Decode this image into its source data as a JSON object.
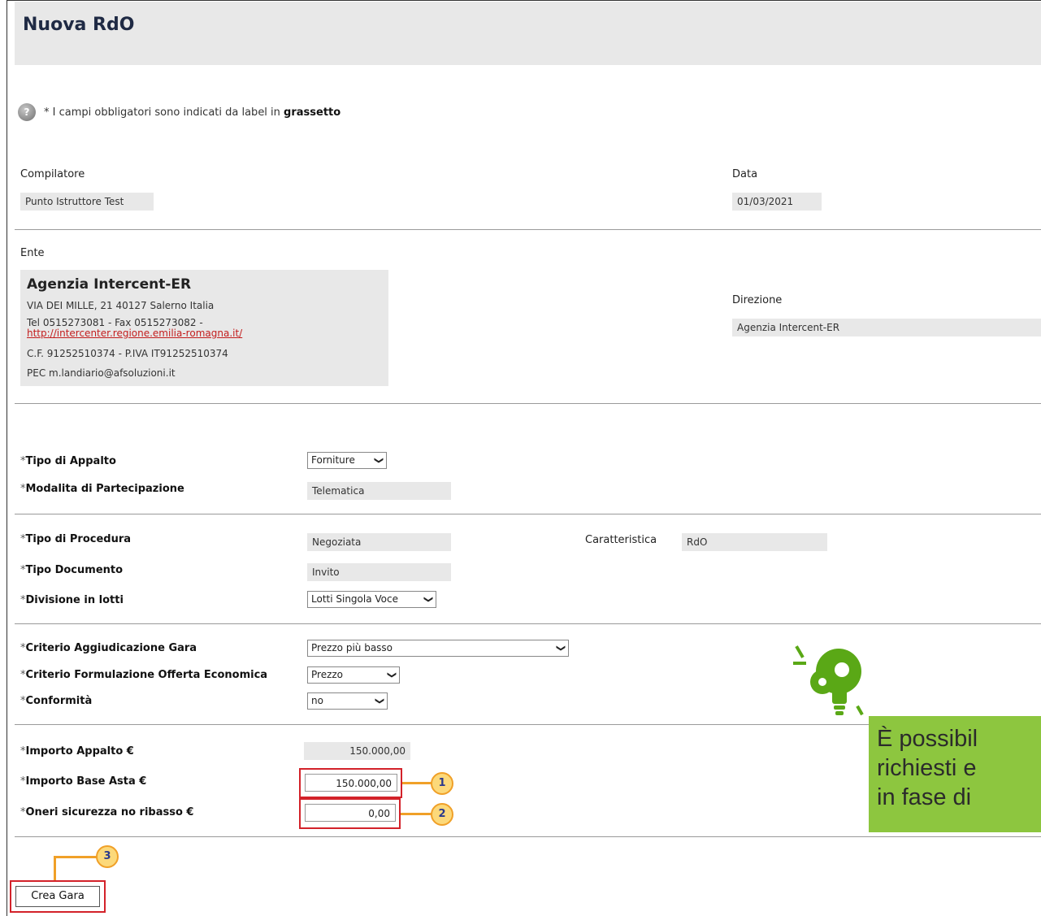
{
  "page": {
    "title": "Nuova RdO"
  },
  "note": {
    "text": "* I campi obbligatori sono indicati da label in ",
    "bold": "grassetto"
  },
  "compilatore": {
    "label": "Compilatore",
    "value": "Punto Istruttore Test"
  },
  "data": {
    "label": "Data",
    "value": "01/03/2021"
  },
  "ente": {
    "label": "Ente",
    "name": "Agenzia Intercent-ER",
    "address": "VIA DEI MILLE, 21 40127 Salerno Italia",
    "phone": "Tel 0515273081 - Fax 0515273082 -",
    "url": "http://intercenter.regione.emilia-romagna.it/",
    "fiscal": "C.F. 91252510374 - P.IVA IT91252510374",
    "pec": "PEC m.landiario@afsoluzioni.it"
  },
  "direzione": {
    "label": "Direzione",
    "value": "Agenzia Intercent-ER"
  },
  "fields": {
    "tipo_appalto": {
      "label": "Tipo di Appalto",
      "value": "Forniture"
    },
    "modalita": {
      "label": "Modalita di Partecipazione",
      "value": "Telematica"
    },
    "tipo_procedura": {
      "label": "Tipo di Procedura",
      "value": "Negoziata"
    },
    "caratteristica": {
      "label": "Caratteristica",
      "value": "RdO"
    },
    "tipo_documento": {
      "label": "Tipo Documento",
      "value": "Invito"
    },
    "divisione_lotti": {
      "label": "Divisione in lotti",
      "value": "Lotti Singola Voce"
    },
    "criterio_aggiudicazione": {
      "label": "Criterio Aggiudicazione Gara",
      "value": "Prezzo più basso"
    },
    "criterio_formulazione": {
      "label": "Criterio Formulazione Offerta Economica",
      "value": "Prezzo"
    },
    "conformita": {
      "label": "Conformità",
      "value": "no"
    },
    "importo_appalto": {
      "label": "Importo Appalto €",
      "value": "150.000,00"
    },
    "importo_base_asta": {
      "label": "Importo Base Asta €",
      "value": "150.000,00"
    },
    "oneri_sicurezza": {
      "label": "Oneri sicurezza no ribasso €",
      "value": "0,00"
    }
  },
  "asterisk": "*",
  "callouts": [
    "1",
    "2",
    "3"
  ],
  "create_button": "Crea Gara",
  "tip": {
    "line1": "È possibil",
    "line2": "richiesti e",
    "line3": "in fase di"
  },
  "icons": {
    "help": "help-circle-icon",
    "tip": "lightbulb-gear-icon",
    "dropdown": "chevron-down-icon"
  },
  "colors": {
    "highlight": "#d3222a",
    "callout_border": "#f0a028",
    "tip_bg": "#8dc63f",
    "link": "#c31d1d"
  }
}
